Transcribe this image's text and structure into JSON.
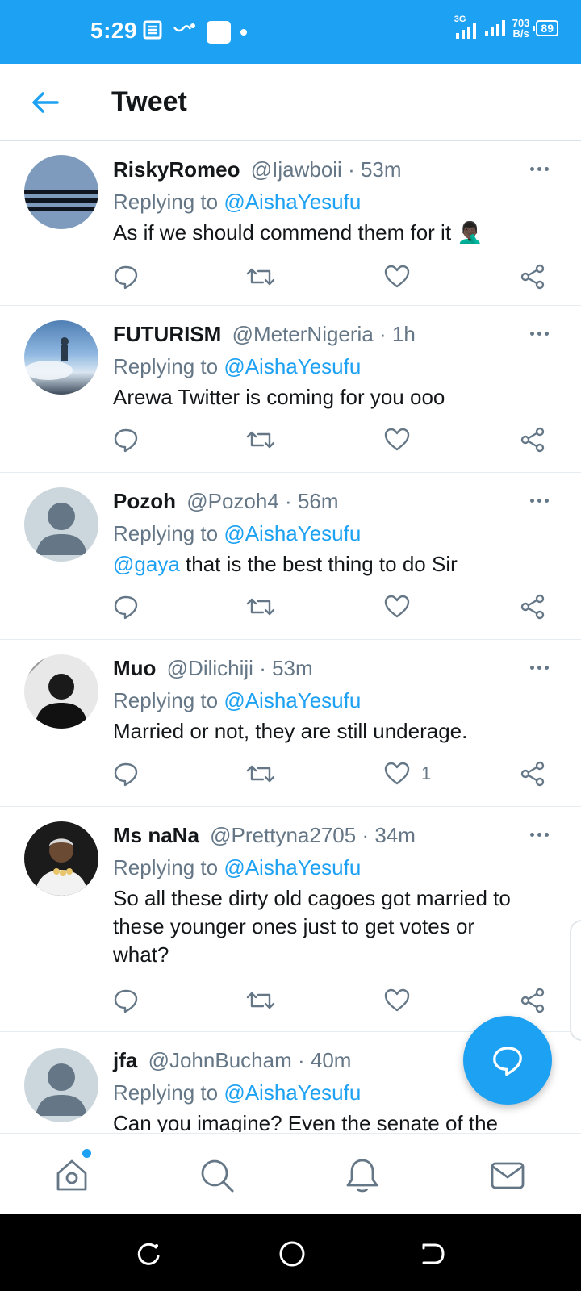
{
  "status_bar": {
    "time": "5:29",
    "network_type": "3G",
    "net_speed_value": "703",
    "net_speed_unit": "B/s",
    "battery": "89"
  },
  "header": {
    "title": "Tweet"
  },
  "tweets": [
    {
      "name": "RiskyRomeo",
      "handle": "@Ijawboii",
      "time": "53m",
      "replying_label": "Replying to",
      "replying_to": "@AishaYesufu",
      "text": "As if we should commend them for it 🤦🏿‍♂️",
      "mention_prefix": "",
      "like_count": ""
    },
    {
      "name": "FUTURISM",
      "handle": "@MeterNigeria",
      "time": "1h",
      "replying_label": "Replying to",
      "replying_to": "@AishaYesufu",
      "text": "Arewa Twitter is coming for you ooo",
      "mention_prefix": "",
      "like_count": ""
    },
    {
      "name": "Pozoh",
      "handle": "@Pozoh4",
      "time": "56m",
      "replying_label": "Replying to",
      "replying_to": "@AishaYesufu",
      "text": " that is the best thing to do Sir",
      "mention_prefix": "@gaya",
      "like_count": ""
    },
    {
      "name": "Muo",
      "handle": "@Dilichiji",
      "time": "53m",
      "replying_label": "Replying to",
      "replying_to": "@AishaYesufu",
      "text": "Married or not, they are still underage.",
      "mention_prefix": "",
      "like_count": "1"
    },
    {
      "name": "Ms naNa",
      "handle": "@Prettyna2705",
      "time": "34m",
      "replying_label": "Replying to",
      "replying_to": "@AishaYesufu",
      "text": "So all these dirty old cagoes got married to these younger ones just to get votes or what?",
      "mention_prefix": "",
      "like_count": ""
    },
    {
      "name": "jfa",
      "handle": "@JohnBucham",
      "time": "40m",
      "replying_label": "Replying to",
      "replying_to": "@AishaYesufu",
      "text": "Can you imagine? Even the senate of the",
      "mention_prefix": "",
      "like_count": ""
    }
  ],
  "colors": {
    "accent": "#1da1f2",
    "text_primary": "#14171a",
    "text_secondary": "#657786"
  },
  "icons": {
    "back": "arrow-left-icon",
    "more": "more-horizontal-icon",
    "reply": "comment-icon",
    "retweet": "retweet-icon",
    "like": "heart-icon",
    "share": "share-icon",
    "compose": "compose-reply-icon",
    "nav": [
      "home-icon",
      "search-icon",
      "notifications-icon",
      "messages-icon"
    ]
  }
}
